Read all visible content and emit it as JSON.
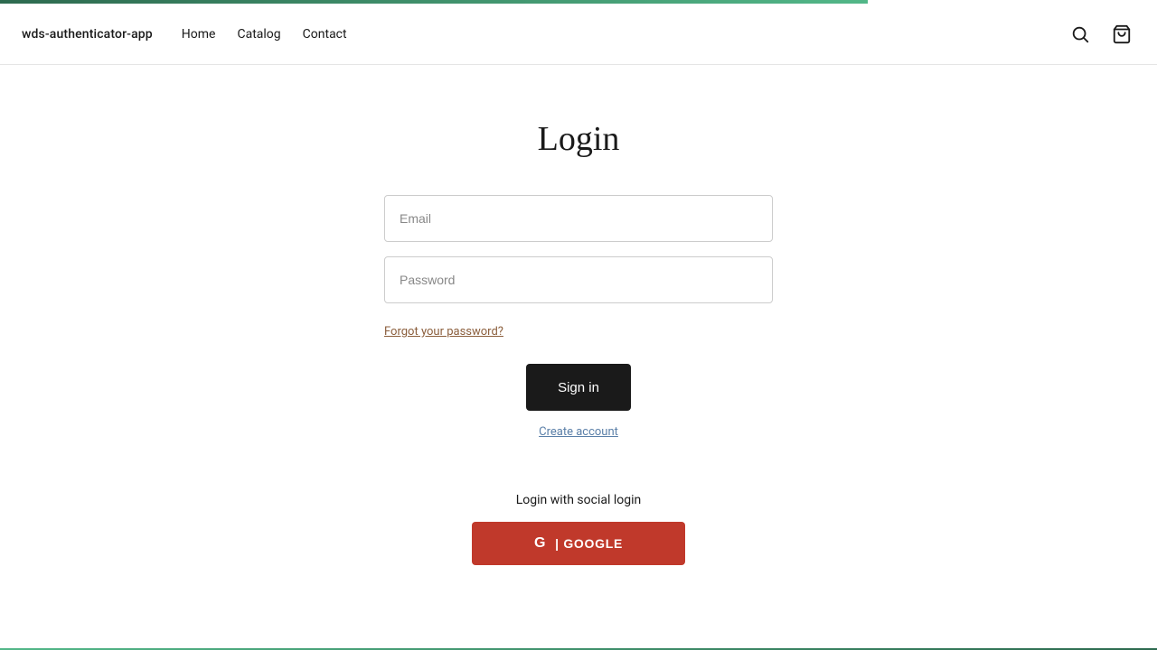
{
  "topBar": {
    "widthPercent": "75%"
  },
  "header": {
    "brandName": "wds-authenticator-app",
    "nav": {
      "home": "Home",
      "catalog": "Catalog",
      "contact": "Contact"
    }
  },
  "login": {
    "title": "Login",
    "emailPlaceholder": "Email",
    "passwordPlaceholder": "Password",
    "forgotPassword": "Forgot your password?",
    "signInButton": "Sign in",
    "createAccount": "Create account"
  },
  "social": {
    "title": "Login with social login",
    "googleButton": "G | GOOGLE"
  }
}
